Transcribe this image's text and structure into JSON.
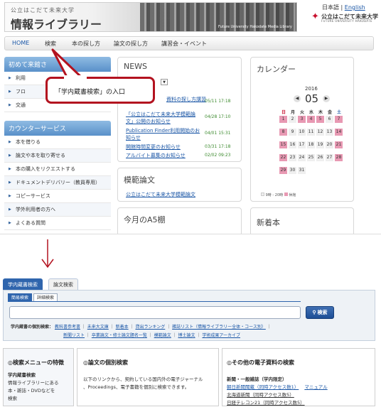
{
  "header": {
    "banner_sub": "公立はこだて未来大学",
    "banner_title": "情報ライブラリー",
    "banner_caption": "Future University Hakodate   Media Library",
    "lang_ja": "日本語",
    "lang_sep": "|",
    "lang_en": "English",
    "logo_jp": "公立はこだて未来大学",
    "logo_en": "FUTURE UNIVERSITY HAKODATE"
  },
  "gnav": [
    "HOME",
    "検索",
    "本の探し方",
    "論文の探し方",
    "講習会・イベント"
  ],
  "sidebar": {
    "first_head": "初めて来館さ",
    "first_items": [
      "利用",
      "フロ",
      "交通"
    ],
    "counter_head": "カウンターサービス",
    "counter_items": [
      "本を借りる",
      "論文や本を取り寄せる",
      "本の購入をリクエストする",
      "ドキュメントデリバリー（教員専用）",
      "コピーサービス",
      "学外利用者の方へ",
      "よくある質問"
    ]
  },
  "news": {
    "title": "NEWS",
    "items": [
      {
        "text": "資料の探し方講習",
        "date": "05/11 17:18"
      },
      {
        "text": "「公立はこだて未来大学模範論文」公開のお知らせ",
        "date": "04/28 17:10"
      },
      {
        "text": "Publication Finder利用開始のお知らせ",
        "date": "04/01 15:31"
      },
      {
        "text": "開館時間変更のお知らせ",
        "date": "03/31 17:18"
      },
      {
        "text": "アルバイト募集のお知らせ",
        "date": "02/02 09:23"
      }
    ]
  },
  "model_papers": {
    "title": "模範論文",
    "link": "公立はこだて未来大学模範論文"
  },
  "a5": {
    "title": "今月のA5棚"
  },
  "calendar": {
    "title": "カレンダー",
    "year": "2016",
    "month": "05",
    "day_names": [
      "日",
      "月",
      "火",
      "水",
      "木",
      "金",
      "土"
    ],
    "weeks": [
      [
        "1",
        "2",
        "3",
        "4",
        "5",
        "6",
        "7"
      ],
      [
        "8",
        "9",
        "10",
        "11",
        "12",
        "13",
        "14"
      ],
      [
        "15",
        "16",
        "17",
        "18",
        "19",
        "20",
        "21"
      ],
      [
        "22",
        "23",
        "24",
        "25",
        "26",
        "27",
        "28"
      ],
      [
        "29",
        "30",
        "31",
        "",
        "",
        "",
        ""
      ]
    ],
    "legend": "9時 - 20時",
    "legend_closed": "休館",
    "pink_color": "#e899b3"
  },
  "new_books": {
    "title": "新着本"
  },
  "callout": {
    "text": "「学内蔵書検索」の入口"
  },
  "search": {
    "tab_active": "学内蔵書検索",
    "tab_other": "論文検索",
    "mini_simple": "簡易検索",
    "mini_detail": "詳細検索",
    "query_value": "",
    "button_label": "検索",
    "index_label": "学内蔵書の個別検索：",
    "index_links1": [
      "教科書参考書",
      "未来大文庫",
      "新着本",
      "貸出ランキング",
      "雑誌リスト（情報ライブラリー全体・コース別）"
    ],
    "index_links2": [
      "新聞リスト",
      "卒業論文・修士論文題名一覧",
      "模範論文",
      "博士論文",
      "学術成果アーカイブ"
    ]
  },
  "boxes": {
    "left_head": "◎検索メニューの特徴",
    "left_sub": "学内蔵書検索",
    "left_text1": "情報ライブラリーにある",
    "left_text2": "本・雑誌・DVDなどを",
    "left_text3": "検索",
    "mid_head": "◎論文の個別検索",
    "mid_text1": "以下のリンクから、契約している国内外の電子ジャーナル",
    "mid_text2": "、Proceedings、電子書籍を個別に検索できます。",
    "right_head": "◎その他の電子資料の検索",
    "right_sub": "新聞・一般雑誌（学内限定）",
    "right_link1": "朝日新聞聞蔵（同時アクセス数1）",
    "right_link1b": "マニュアル",
    "right_link2": "北海道新聞（同時アクセス数5）",
    "right_link3": "日経テレコン21（同時アクセス数5）"
  }
}
